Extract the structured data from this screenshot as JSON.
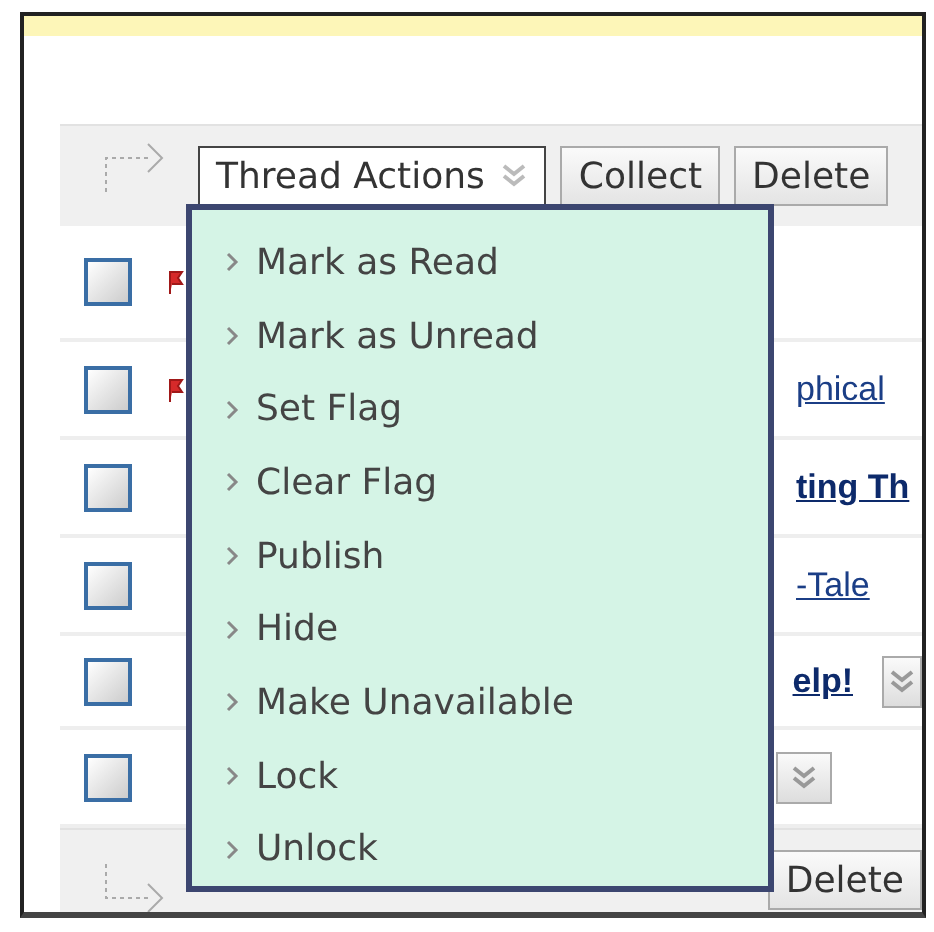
{
  "toolbar_top": {
    "menu_button": {
      "label": "Thread Actions",
      "expanded": true
    },
    "buttons": [
      "Collect",
      "Delete"
    ]
  },
  "header": {
    "checked": false
  },
  "rows": [
    {
      "title": "phical",
      "checked": false,
      "flagged": true,
      "unread": false,
      "menu_button": false
    },
    {
      "title": "ting Th",
      "checked": false,
      "flagged": false,
      "unread": true,
      "menu_button": false
    },
    {
      "title": "-Tale",
      "checked": false,
      "flagged": false,
      "unread": false,
      "menu_button": false
    },
    {
      "title": "elp!",
      "checked": false,
      "flagged": false,
      "unread": true,
      "menu_button": true
    },
    {
      "checked": false,
      "flagged": false,
      "menu_button": true
    }
  ],
  "toolbar_bottom": {
    "buttons": [
      "Delete"
    ]
  },
  "menu": {
    "items": [
      "Mark as Read",
      "Mark as Unread",
      "Set Flag",
      "Clear Flag",
      "Publish",
      "Hide",
      "Make Unavailable",
      "Lock",
      "Unlock"
    ]
  }
}
